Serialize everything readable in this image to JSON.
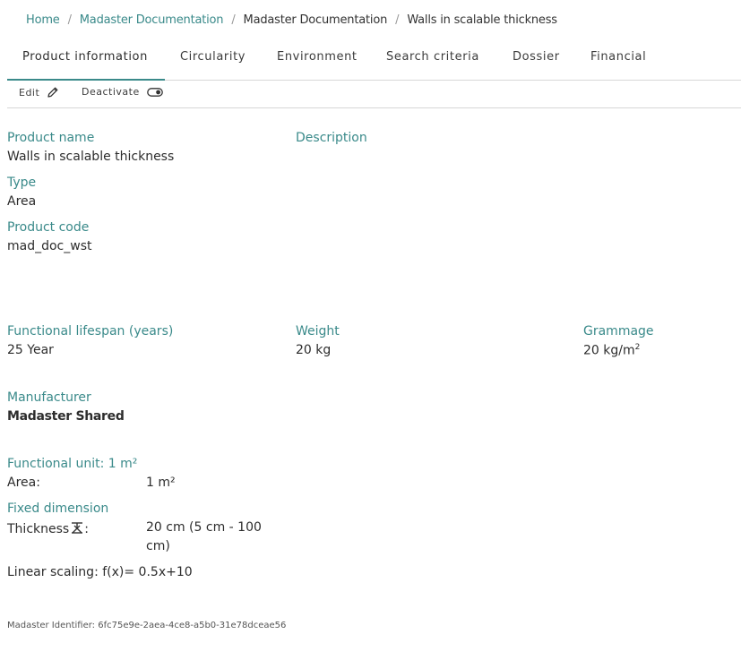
{
  "breadcrumb": {
    "home": "Home",
    "section": "Madaster Documentation",
    "parent": "Madaster Documentation",
    "current": "Walls in scalable thickness",
    "separator": "/"
  },
  "tabs": [
    {
      "label": "Product information",
      "active": true
    },
    {
      "label": "Circularity"
    },
    {
      "label": "Environment"
    },
    {
      "label": "Search criteria"
    },
    {
      "label": "Dossier"
    },
    {
      "label": "Financial"
    }
  ],
  "toolbar": {
    "edit_label": "Edit",
    "edit_icon": "pencil-icon",
    "deactivate_label": "Deactivate",
    "deactivate_icon": "toggle-icon"
  },
  "product": {
    "name_label": "Product name",
    "name_value": "Walls in scalable thickness",
    "description_label": "Description",
    "description_value": "",
    "type_label": "Type",
    "type_value": "Area",
    "code_label": "Product code",
    "code_value": "mad_doc_wst"
  },
  "specs": {
    "lifespan_label": "Functional lifespan (years)",
    "lifespan_value": "25 Year",
    "weight_label": "Weight",
    "weight_value": "20 kg",
    "grammage_label": "Grammage",
    "grammage_value": "20 kg/m",
    "grammage_sup": "2"
  },
  "manufacturer": {
    "label": "Manufacturer",
    "value": "Madaster Shared"
  },
  "functional_unit": {
    "label": "Functional unit: 1 m²",
    "area_label": "Area:",
    "area_value": "1 m²"
  },
  "fixed_dimension": {
    "label": "Fixed dimension",
    "thickness_label": "Thickness",
    "thickness_colon": ":",
    "thickness_icon": "thickness-icon",
    "thickness_value_line1": "20 cm (5 cm - 100",
    "thickness_value_line2": "cm)",
    "scaling": "Linear scaling: f(x)= 0.5x+10"
  },
  "identifier": "Madaster Identifier: 6fc75e9e-2aea-4ce8-a5b0-31e78dceae56",
  "colors": {
    "accent": "#3a8a8a",
    "text": "#2d2d2d",
    "divider": "#d7d7d7"
  }
}
